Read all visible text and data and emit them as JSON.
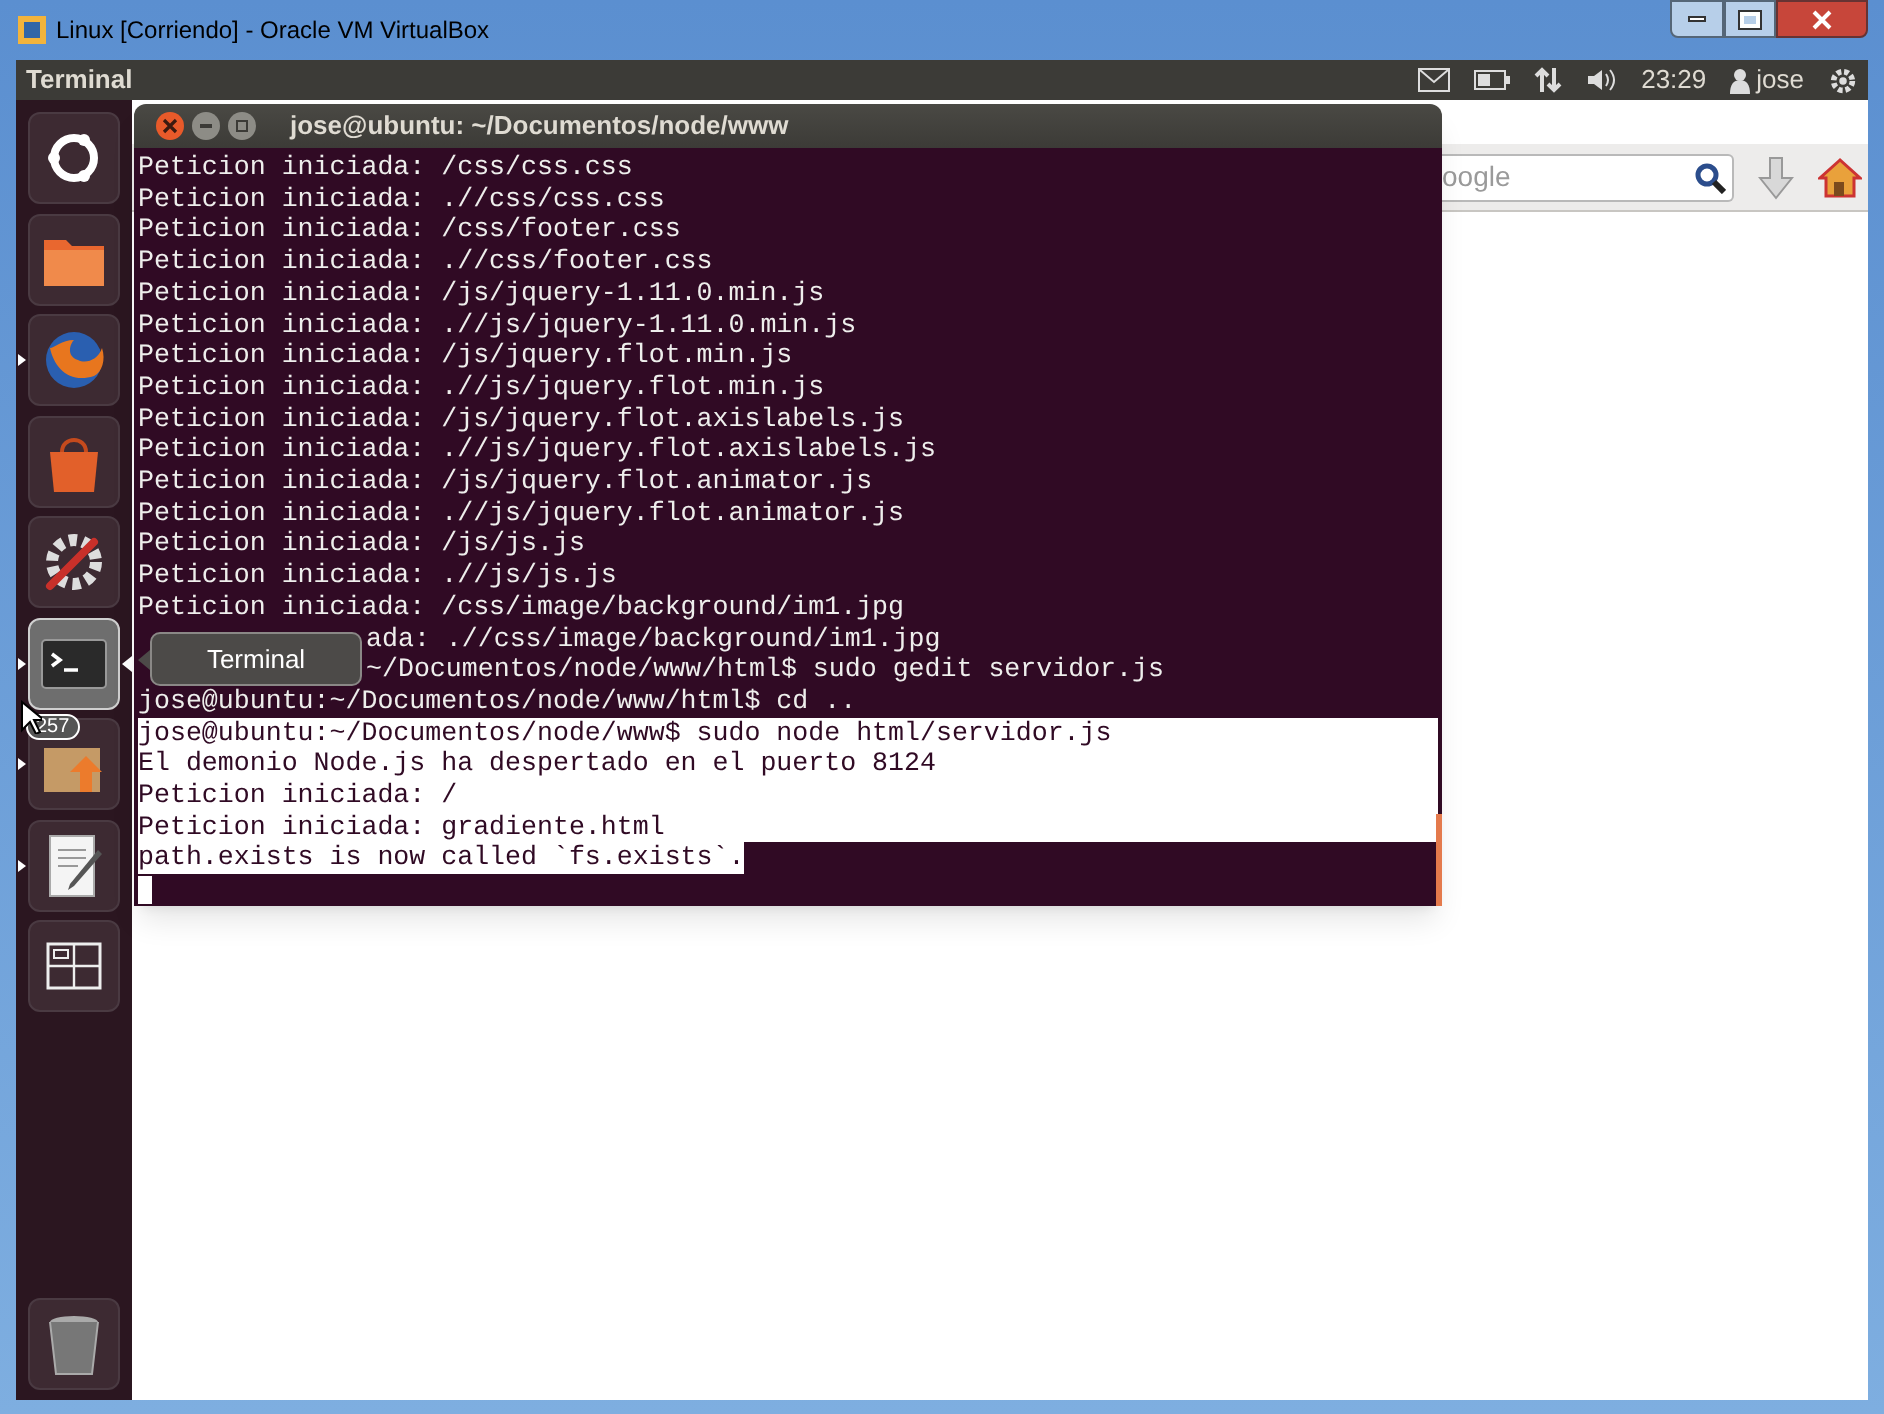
{
  "vm_window": {
    "title": "Linux [Corriendo] - Oracle VM VirtualBox"
  },
  "top_panel": {
    "app_name": "Terminal",
    "clock": "23:29",
    "user": "jose"
  },
  "launcher": {
    "items": [
      {
        "kind": "dash",
        "running": false,
        "active": false
      },
      {
        "kind": "files",
        "running": false,
        "active": false
      },
      {
        "kind": "firefox",
        "running": true,
        "active": false
      },
      {
        "kind": "store",
        "running": false,
        "active": false
      },
      {
        "kind": "settings",
        "running": false,
        "active": false
      },
      {
        "kind": "terminal",
        "running": true,
        "active": true
      },
      {
        "kind": "updates",
        "running": true,
        "active": false,
        "badge": "257"
      },
      {
        "kind": "editor",
        "running": true,
        "active": false
      },
      {
        "kind": "workspaces",
        "running": false,
        "active": false
      },
      {
        "kind": "trash",
        "running": false,
        "active": false
      }
    ]
  },
  "tooltip": {
    "text": "Terminal"
  },
  "browser": {
    "search": {
      "placeholder": "oogle"
    }
  },
  "terminal": {
    "title": "jose@ubuntu: ~/Documentos/node/www",
    "lines": [
      {
        "text": "Peticion iniciada: /css/css.css",
        "selected": false
      },
      {
        "text": "Peticion iniciada: .//css/css.css",
        "selected": false
      },
      {
        "text": "Peticion iniciada: /css/footer.css",
        "selected": false
      },
      {
        "text": "Peticion iniciada: .//css/footer.css",
        "selected": false
      },
      {
        "text": "Peticion iniciada: /js/jquery-1.11.0.min.js",
        "selected": false
      },
      {
        "text": "Peticion iniciada: .//js/jquery-1.11.0.min.js",
        "selected": false
      },
      {
        "text": "Peticion iniciada: /js/jquery.flot.min.js",
        "selected": false
      },
      {
        "text": "Peticion iniciada: .//js/jquery.flot.min.js",
        "selected": false
      },
      {
        "text": "Peticion iniciada: /js/jquery.flot.axislabels.js",
        "selected": false
      },
      {
        "text": "Peticion iniciada: .//js/jquery.flot.axislabels.js",
        "selected": false
      },
      {
        "text": "Peticion iniciada: /js/jquery.flot.animator.js",
        "selected": false
      },
      {
        "text": "Peticion iniciada: .//js/jquery.flot.animator.js",
        "selected": false
      },
      {
        "text": "Peticion iniciada: /js/js.js",
        "selected": false
      },
      {
        "text": "Peticion iniciada: .//js/js.js",
        "selected": false
      },
      {
        "text": "Peticion iniciada: /css/image/background/im1.jpg",
        "selected": false
      },
      {
        "text": "ada: .//css/image/background/im1.jpg",
        "selected": false,
        "kind": "covered"
      },
      {
        "text": "~/Documentos/node/www/html$ sudo gedit servidor.js",
        "selected": false,
        "kind": "covered"
      },
      {
        "text": "jose@ubuntu:~/Documentos/node/www/html$ cd ..",
        "selected": false
      },
      {
        "text": "jose@ubuntu:~/Documentos/node/www$ sudo node html/servidor.js",
        "selected": true
      },
      {
        "text": "El demonio Node.js ha despertado en el puerto 8124",
        "selected": true
      },
      {
        "text": "Peticion iniciada: /",
        "selected": true
      },
      {
        "text": "Peticion iniciada: gradiente.html",
        "selected": true
      },
      {
        "text": "path.exists is now called `fs.exists`.",
        "selected": true
      }
    ]
  }
}
